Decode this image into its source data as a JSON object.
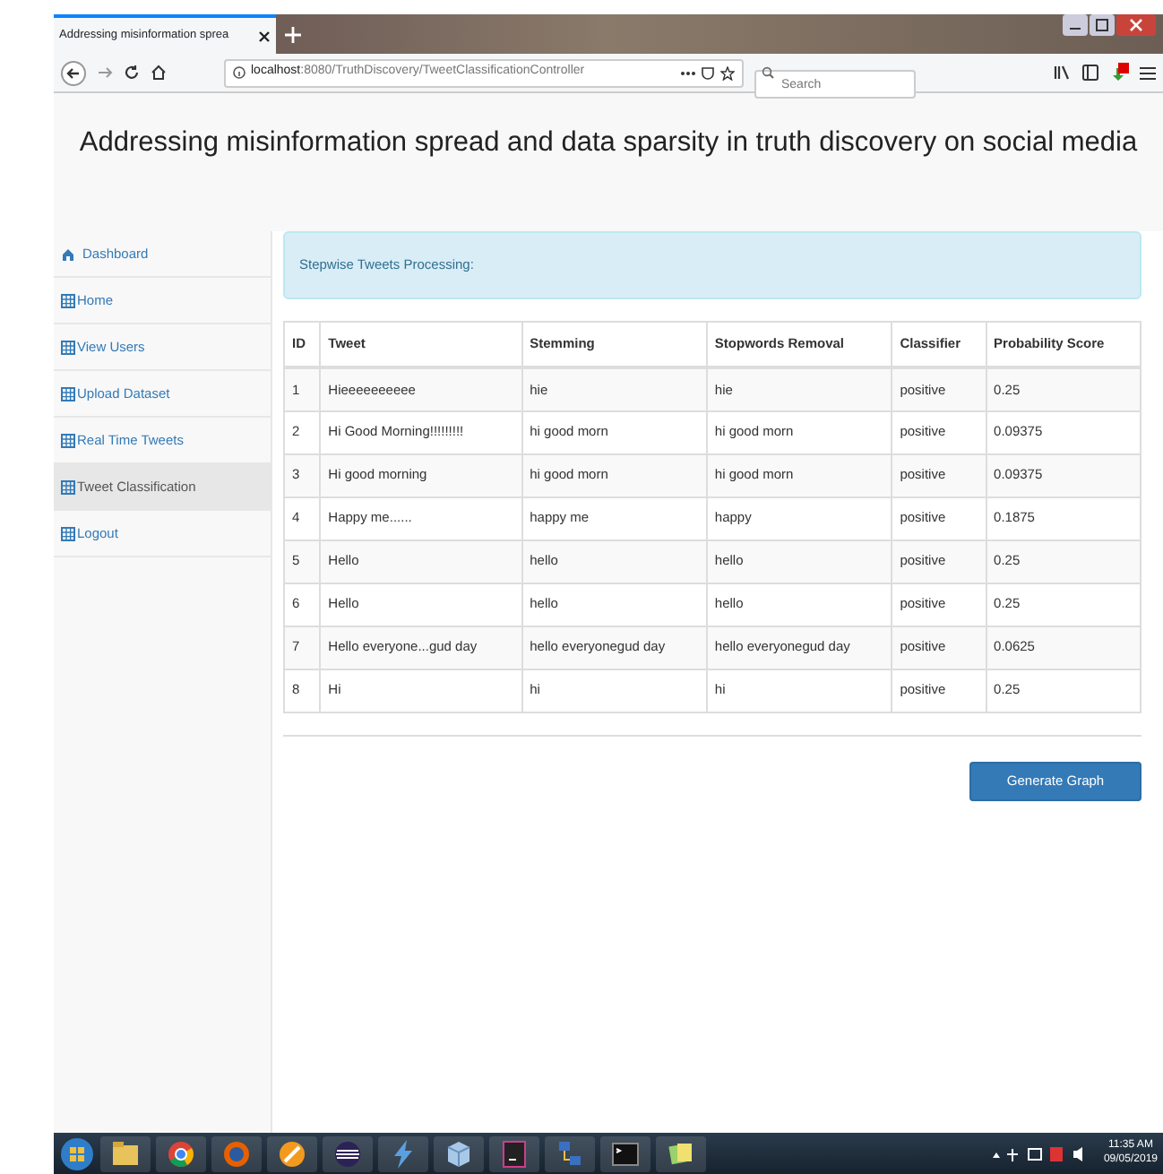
{
  "browser": {
    "tab_title": "Addressing misinformation sprea",
    "url_host": "localhost",
    "url_path": ":8080/TruthDiscovery/TweetClassificationController",
    "search_placeholder": "Search"
  },
  "page_title": "Addressing misinformation spread and data sparsity in truth discovery on social media",
  "sidebar": {
    "items": [
      {
        "label": "Dashboard",
        "kind": "home",
        "selected": false
      },
      {
        "label": "Home",
        "kind": "table",
        "selected": false
      },
      {
        "label": "View Users",
        "kind": "table",
        "selected": false
      },
      {
        "label": "Upload Dataset",
        "kind": "table",
        "selected": false
      },
      {
        "label": "Real Time Tweets",
        "kind": "table",
        "selected": false
      },
      {
        "label": "Tweet Classification",
        "kind": "table",
        "selected": true
      },
      {
        "label": "Logout",
        "kind": "table",
        "selected": false
      }
    ]
  },
  "alert": "Stepwise Tweets Processing:",
  "table": {
    "columns": [
      "ID",
      "Tweet",
      "Stemming",
      "Stopwords Removal",
      "Classifier",
      "Probability Score"
    ],
    "rows": [
      [
        "1",
        "Hieeeeeeeeee",
        "hie",
        "hie",
        "positive",
        "0.25"
      ],
      [
        "2",
        "Hi Good Morning!!!!!!!!!",
        "hi good morn",
        "hi good morn",
        "positive",
        "0.09375"
      ],
      [
        "3",
        "Hi good morning",
        "hi good morn",
        "hi good morn",
        "positive",
        "0.09375"
      ],
      [
        "4",
        "Happy me......",
        "happy me",
        "happy",
        "positive",
        "0.1875"
      ],
      [
        "5",
        "Hello",
        "hello",
        "hello",
        "positive",
        "0.25"
      ],
      [
        "6",
        "Hello",
        "hello",
        "hello",
        "positive",
        "0.25"
      ],
      [
        "7",
        "Hello everyone...gud day",
        "hello everyonegud day",
        "hello everyonegud day",
        "positive",
        "0.0625"
      ],
      [
        "8",
        "Hi",
        "hi",
        "hi",
        "positive",
        "0.25"
      ]
    ]
  },
  "button": "Generate Graph",
  "taskbar": {
    "time": "11:35 AM",
    "date": "09/05/2019"
  }
}
